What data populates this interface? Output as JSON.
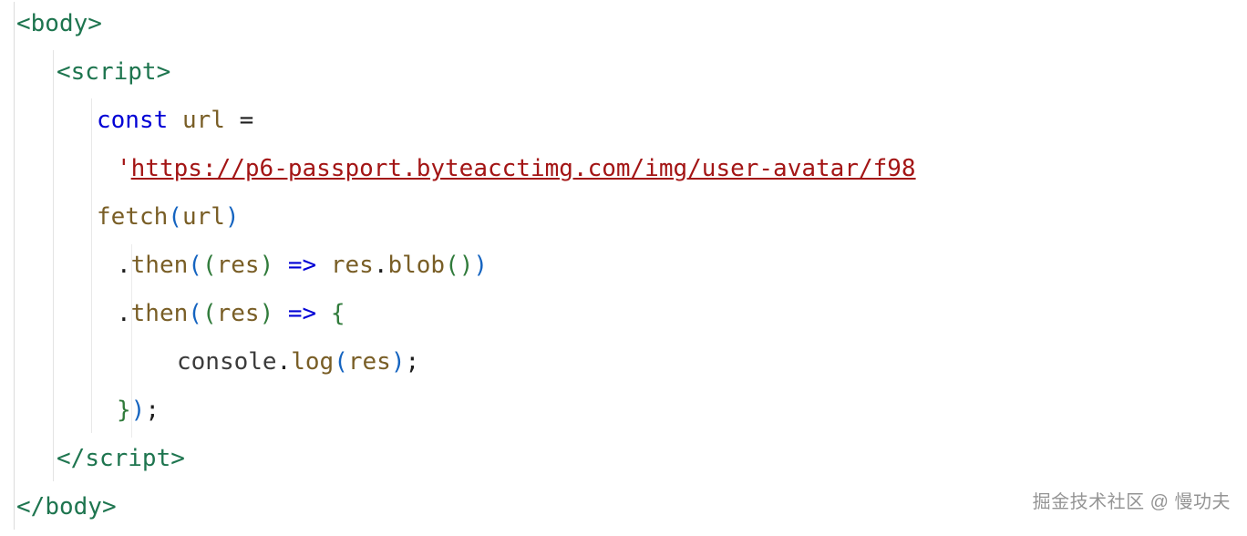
{
  "code": {
    "line1": {
      "open": "<",
      "tag": "body",
      "close": ">"
    },
    "line2": {
      "open": "<",
      "tag": "script",
      "close": ">"
    },
    "line3": {
      "kw": "const",
      "name": "url",
      "eq": "="
    },
    "line4": {
      "q1": "'",
      "url": "https://p6-passport.byteacctimg.com/img/user-avatar/f98"
    },
    "line5": {
      "fn": "fetch",
      "lp": "(",
      "arg": "url",
      "rp": ")"
    },
    "line6": {
      "dot": ".",
      "then": "then",
      "lp1": "(",
      "lp2": "(",
      "arg": "res",
      "rp2": ")",
      "arrow": "=>",
      "obj": "res",
      "dot2": ".",
      "blob": "blob",
      "lp3": "(",
      "rp3": ")",
      "rp1": ")"
    },
    "line7": {
      "dot": ".",
      "then": "then",
      "lp1": "(",
      "lp2": "(",
      "arg": "res",
      "rp2": ")",
      "arrow": "=>",
      "brace": "{"
    },
    "line8": {
      "console": "console",
      "dot": ".",
      "log": "log",
      "lp": "(",
      "arg": "res",
      "rp": ")",
      "semi": ";"
    },
    "line9": {
      "brace": "}",
      "rp": ")",
      "semi": ";"
    },
    "line10": {
      "open": "</",
      "tag": "script",
      "close": ">"
    },
    "line11": {
      "open": "</",
      "tag": "body",
      "close": ">"
    }
  },
  "watermark": "掘金技术社区 @ 慢功夫"
}
